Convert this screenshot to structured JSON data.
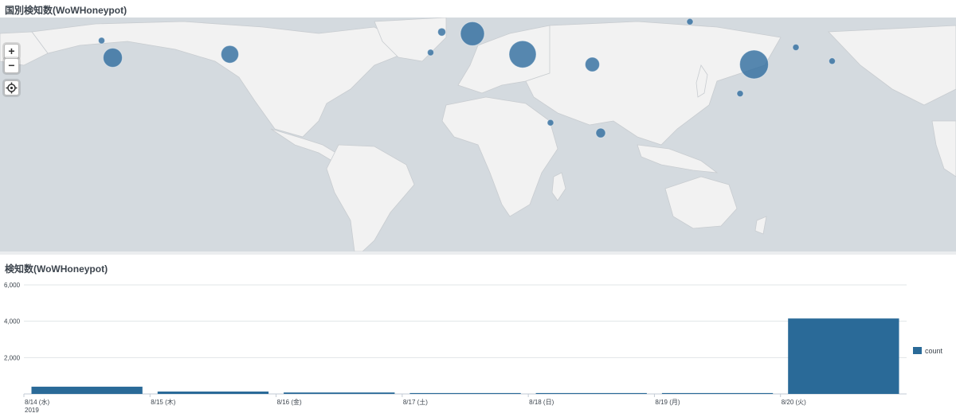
{
  "map_panel": {
    "title": "国別検知数(WoWHoneypot)",
    "controls": {
      "zoom_in": "+",
      "zoom_out": "−"
    },
    "bubbles": [
      {
        "name": "us-west",
        "lon": -119,
        "lat": 37,
        "r": 12
      },
      {
        "name": "us-east",
        "lon": -77,
        "lat": 39,
        "r": 11
      },
      {
        "name": "us-northwest",
        "lon": -123,
        "lat": 47,
        "r": 4
      },
      {
        "name": "uk",
        "lon": -1,
        "lat": 52,
        "r": 5
      },
      {
        "name": "spain",
        "lon": -5,
        "lat": 40,
        "r": 4
      },
      {
        "name": "germany",
        "lon": 10,
        "lat": 51,
        "r": 15
      },
      {
        "name": "turkey",
        "lon": 28,
        "lat": 39,
        "r": 17
      },
      {
        "name": "russia",
        "lon": 88,
        "lat": 58,
        "r": 4
      },
      {
        "name": "iran",
        "lon": 53,
        "lat": 33,
        "r": 9
      },
      {
        "name": "china",
        "lon": 111,
        "lat": 33,
        "r": 18
      },
      {
        "name": "korea-north",
        "lon": 126,
        "lat": 43,
        "r": 4
      },
      {
        "name": "japan",
        "lon": 139,
        "lat": 35,
        "r": 4
      },
      {
        "name": "vietnam",
        "lon": 106,
        "lat": 16,
        "r": 4
      },
      {
        "name": "kenya",
        "lon": 38,
        "lat": -1,
        "r": 4
      },
      {
        "name": "seychelles",
        "lon": 56,
        "lat": -7,
        "r": 6
      }
    ],
    "colors": {
      "ocean": "#d4dadf",
      "land": "#f2f2f2",
      "bubble": "#2e6b9e"
    }
  },
  "chart_panel": {
    "title": "検知数(WoWHoneypot)"
  },
  "chart_data": {
    "type": "bar",
    "title": "検知数(WoWHoneypot)",
    "categories": [
      "8/14 (水)",
      "8/15 (木)",
      "8/16 (金)",
      "8/17 (土)",
      "8/18 (日)",
      "8/19 (月)",
      "8/20 (火)"
    ],
    "year_label": "2019",
    "series": [
      {
        "name": "count",
        "values": [
          400,
          130,
          80,
          50,
          50,
          50,
          4150
        ]
      }
    ],
    "ylim": [
      0,
      6000
    ],
    "yticks": [
      2000,
      4000,
      6000
    ],
    "ytick_labels": [
      "2,000",
      "4,000",
      "6,000"
    ],
    "grid": true,
    "legend_placement": "right",
    "colors": {
      "bar": "#2a6a98"
    }
  }
}
